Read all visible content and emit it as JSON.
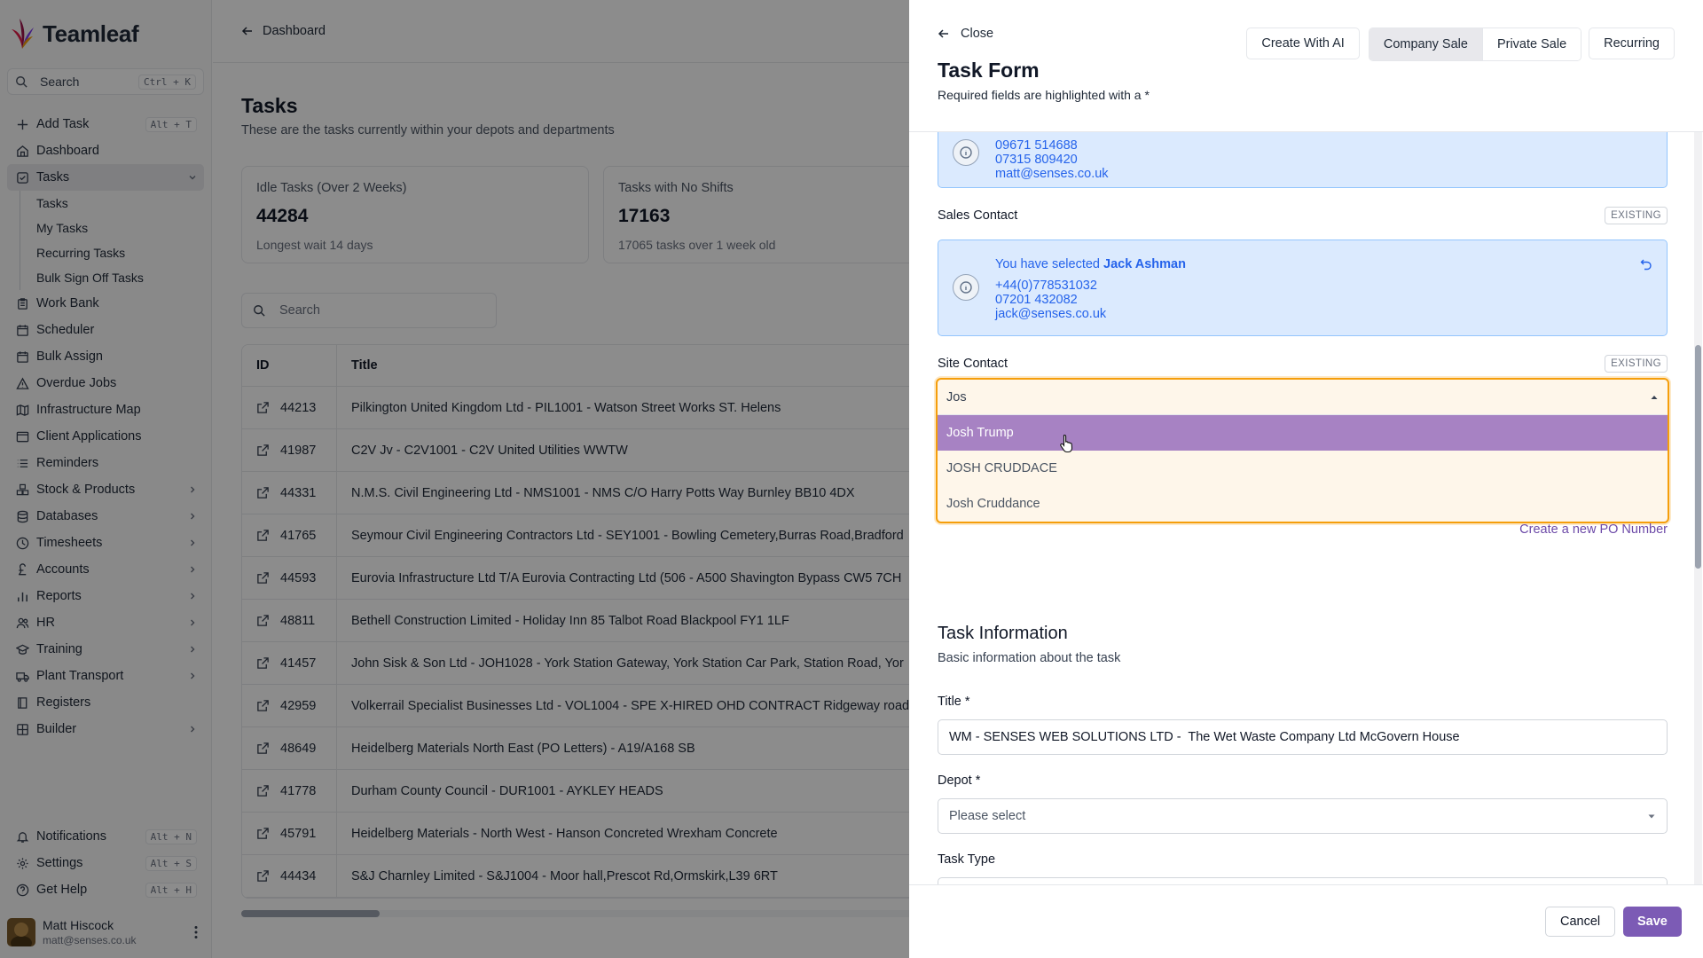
{
  "app": {
    "name": "Teamleaf",
    "brand_color": "#7c5bb5"
  },
  "sidebar": {
    "search_label": "Search",
    "search_shortcut": "Ctrl + K",
    "items": [
      {
        "label": "Add Task",
        "shortcut": "Alt + T",
        "icon": "plus-icon"
      },
      {
        "label": "Dashboard",
        "icon": "home-icon"
      },
      {
        "label": "Tasks",
        "icon": "check-square-icon",
        "expanded": true
      },
      {
        "label": "Work Bank",
        "icon": "clipboard-icon"
      },
      {
        "label": "Scheduler",
        "icon": "calendar-icon"
      },
      {
        "label": "Bulk Assign",
        "icon": "calendar-icon"
      },
      {
        "label": "Overdue Jobs",
        "icon": "warning-icon"
      },
      {
        "label": "Infrastructure Map",
        "icon": "map-icon"
      },
      {
        "label": "Client Applications",
        "icon": "window-icon"
      },
      {
        "label": "Reminders",
        "icon": "list-icon"
      },
      {
        "label": "Stock & Products",
        "icon": "boxes-icon"
      },
      {
        "label": "Databases",
        "icon": "database-icon"
      },
      {
        "label": "Timesheets",
        "icon": "clock-icon"
      },
      {
        "label": "Accounts",
        "icon": "pound-icon"
      },
      {
        "label": "Reports",
        "icon": "bar-chart-icon"
      },
      {
        "label": "HR",
        "icon": "users-icon"
      },
      {
        "label": "Training",
        "icon": "graduation-icon"
      },
      {
        "label": "Plant Transport",
        "icon": "truck-icon"
      },
      {
        "label": "Registers",
        "icon": "book-icon"
      },
      {
        "label": "Builder",
        "icon": "grid-icon"
      }
    ],
    "task_sub_items": [
      "Tasks",
      "My Tasks",
      "Recurring Tasks",
      "Bulk Sign Off Tasks"
    ],
    "bottom": [
      {
        "label": "Notifications",
        "shortcut": "Alt + N"
      },
      {
        "label": "Settings",
        "shortcut": "Alt + S"
      },
      {
        "label": "Get Help",
        "shortcut": "Alt + H"
      }
    ],
    "user": {
      "name": "Matt Hiscock",
      "email": "matt@senses.co.uk"
    }
  },
  "main": {
    "breadcrumb": "Dashboard",
    "title": "Tasks",
    "subtitle": "These are the tasks currently within your depots and departments",
    "cards": [
      {
        "label": "Idle Tasks (Over 2 Weeks)",
        "value": "44284",
        "note": "Longest wait 14 days"
      },
      {
        "label": "Tasks with No Shifts",
        "value": "17163",
        "note": "17065 tasks over 1 week old"
      }
    ],
    "search_placeholder": "Search",
    "table": {
      "headers": [
        "ID",
        "Title"
      ],
      "rows": [
        {
          "id": "44213",
          "title": "Pilkington United Kingdom Ltd - PIL1001 - Watson Street Works ST. Helens"
        },
        {
          "id": "41987",
          "title": "C2V Jv - C2V1001 - C2V United Utilities WWTW"
        },
        {
          "id": "44331",
          "title": "N.M.S. Civil Engineering Ltd - NMS1001 - NMS C/O Harry Potts Way Burnley BB10 4DX"
        },
        {
          "id": "41765",
          "title": "Seymour Civil Engineering Contractors Ltd - SEY1001 - Bowling Cemetery,Burras Road,Bradford"
        },
        {
          "id": "44593",
          "title": "Eurovia Infrastructure Ltd T/A Eurovia Contracting Ltd (506 - A500 Shavington Bypass CW5 7CH"
        },
        {
          "id": "48811",
          "title": "Bethell Construction Limited - Holiday Inn 85 Talbot Road Blackpool FY1 1LF"
        },
        {
          "id": "41457",
          "title": "John Sisk & Son Ltd - JOH1028 - York Station Gateway, York Station Car Park, Station Road, Yor"
        },
        {
          "id": "42959",
          "title": "Volkerrail Specialist Businesses Ltd - VOL1004 - SPE X-HIRED OHD CONTRACT Ridgeway road/"
        },
        {
          "id": "48649",
          "title": "Heidelberg Materials North East (PO Letters) - A19/A168 SB"
        },
        {
          "id": "41778",
          "title": "Durham County Council - DUR1001 - AYKLEY HEADS"
        },
        {
          "id": "45791",
          "title": "Heidelberg Materials - North West - Hanson Concreted Wrexham Concrete"
        },
        {
          "id": "44434",
          "title": "S&J Charnley Limited - S&J1004 - Moor hall,Prescot Rd,Ormskirk,L39 6RT"
        }
      ]
    }
  },
  "drawer": {
    "close_label": "Close",
    "title": "Task Form",
    "subtitle": "Required fields are highlighted with a *",
    "header_buttons": {
      "create_ai": "Create With AI",
      "company_sale": "Company Sale",
      "private_sale": "Private Sale",
      "recurring": "Recurring"
    },
    "prev_contact": {
      "phone1": "09671 514688",
      "phone2": "07315 809420",
      "email": "matt@senses.co.uk"
    },
    "sales_contact": {
      "label": "Sales Contact",
      "badge": "EXISTING",
      "selected_prefix": "You have selected",
      "selected_name": "Jack Ashman",
      "phone1": "+44(0)778531032",
      "phone2": "07201 432082",
      "email": "jack@senses.co.uk"
    },
    "site_contact": {
      "label": "Site Contact",
      "badge": "EXISTING",
      "input_value": "Jos",
      "options": [
        "Josh Trump",
        "JOSH CRUDDACE",
        "Josh Cruddance"
      ]
    },
    "po_link": "Create a new PO Number",
    "task_info": {
      "title": "Task Information",
      "subtitle": "Basic information about the task",
      "title_label": "Title *",
      "title_value": "WM - SENSES WEB SOLUTIONS LTD -  The Wet Waste Company Ltd McGovern House",
      "depot_label": "Depot *",
      "depot_placeholder": "Please select",
      "task_type_label": "Task Type"
    },
    "footer": {
      "cancel": "Cancel",
      "save": "Save"
    }
  }
}
